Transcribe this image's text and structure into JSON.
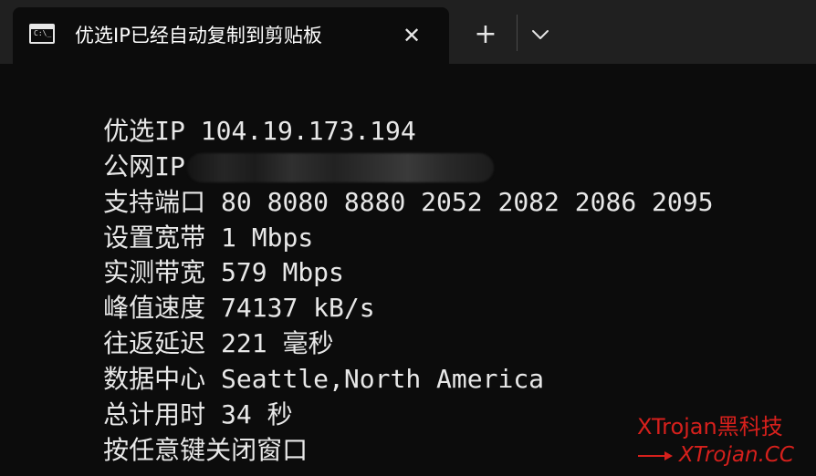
{
  "window": {
    "tab_title": "优选IP已经自动复制到剪贴板",
    "tab_icon_text": "C:\\_",
    "close_glyph": "✕",
    "new_tab_glyph": "+",
    "dropdown_icon": "chevron-down-icon"
  },
  "terminal": {
    "lines": [
      {
        "label": "优选IP",
        "value": " 104.19.173.194"
      },
      {
        "label": "公网IP",
        "value": ""
      },
      {
        "label": "支持端口",
        "value": " 80 8080 8880 2052 2082 2086 2095"
      },
      {
        "label": "设置宽带",
        "value": " 1 Mbps"
      },
      {
        "label": "实测带宽",
        "value": " 579 Mbps"
      },
      {
        "label": "峰值速度",
        "value": " 74137 kB/s"
      },
      {
        "label": "往返延迟",
        "value": " 221 毫秒"
      },
      {
        "label": "数据中心",
        "value": " Seattle,North America"
      },
      {
        "label": "总计用时",
        "value": " 34 秒"
      },
      {
        "label": "按任意键关闭窗口",
        "value": ""
      }
    ]
  },
  "watermark": {
    "brand": "XTrojan黑科技",
    "url": "XTrojan.CC",
    "color": "#d6201c"
  },
  "colors": {
    "titlebar": "#202020",
    "background": "#0c0c0c",
    "text": "#e8e8e8"
  }
}
